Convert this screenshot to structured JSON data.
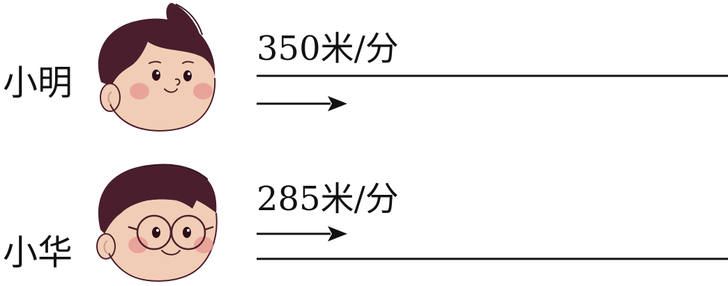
{
  "people": [
    {
      "name": "小明",
      "speed": "350米/分"
    },
    {
      "name": "小华",
      "speed": "285米/分"
    }
  ],
  "colors": {
    "hair": "#4a1e2c",
    "skin": "#f2cdb6",
    "cheek": "#e69a93",
    "ink": "#111111"
  }
}
